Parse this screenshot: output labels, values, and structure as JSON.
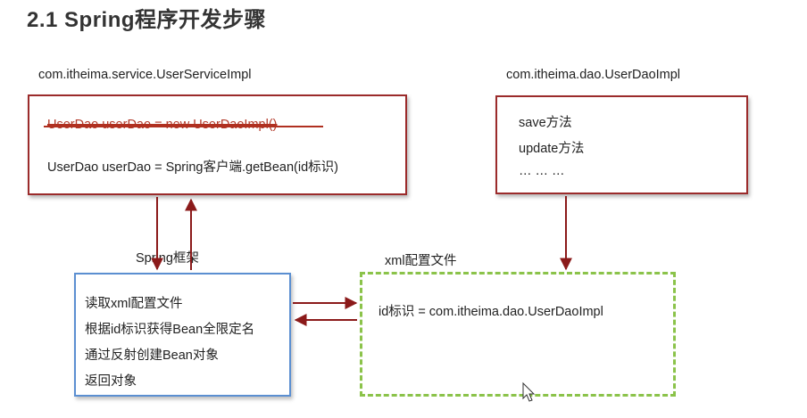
{
  "title": "2.1 Spring程序开发步骤",
  "service": {
    "class_name": "com.itheima.service.UserServiceImpl",
    "old_line": "UserDao userDao = new UserDaoImpl()",
    "new_line": "UserDao userDao = Spring客户端.getBean(id标识)"
  },
  "dao": {
    "class_name": "com.itheima.dao.UserDaoImpl",
    "methods": [
      "save方法",
      "update方法",
      "… … …"
    ]
  },
  "framework": {
    "label": "Spring框架",
    "steps": [
      "读取xml配置文件",
      "根据id标识获得Bean全限定名",
      "通过反射创建Bean对象",
      "返回对象"
    ]
  },
  "xml": {
    "label": "xml配置文件",
    "content": "id标识 = com.itheima.dao.UserDaoImpl"
  },
  "colors": {
    "arrow": "#8b1a1a",
    "box_border_dark": "#9b2b2b",
    "framework_border": "#5b8fd1",
    "xml_border": "#8bc34a"
  }
}
